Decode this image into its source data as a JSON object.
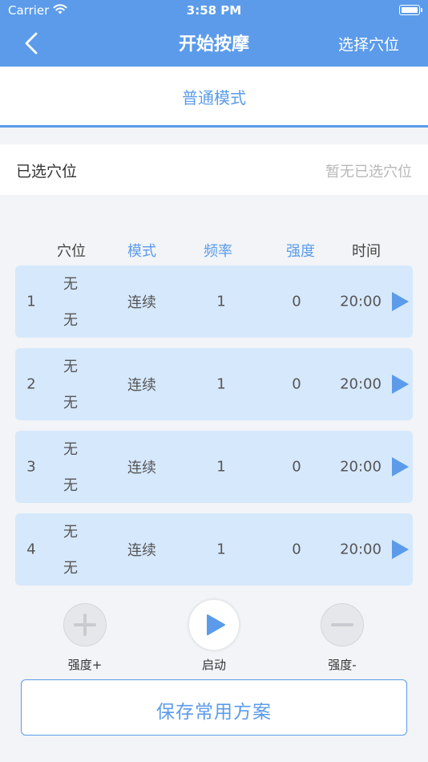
{
  "status_bar": {
    "carrier": "Carrier",
    "time": "3:58 PM",
    "wifi_icon": "wifi-icon",
    "battery_icon": "battery-icon"
  },
  "nav": {
    "back_icon": "chevron-left-icon",
    "title": "开始按摩",
    "select_acupoint": "选择穴位"
  },
  "mode_tab": {
    "label": "普通模式"
  },
  "selected": {
    "label": "已选穴位",
    "value": "暂无已选穴位"
  },
  "table": {
    "headers": [
      "穴位",
      "模式",
      "频率",
      "强度",
      "时间"
    ],
    "header_colors": [
      "#444444",
      "#5b9bea",
      "#5b9bea",
      "#5b9bea",
      "#444444"
    ],
    "rows": [
      {
        "index": "1",
        "point_top": "无",
        "point_bottom": "无",
        "mode": "连续",
        "frequency": "1",
        "intensity": "0",
        "time": "20:00"
      },
      {
        "index": "2",
        "point_top": "无",
        "point_bottom": "无",
        "mode": "连续",
        "frequency": "1",
        "intensity": "0",
        "time": "20:00"
      },
      {
        "index": "3",
        "point_top": "无",
        "point_bottom": "无",
        "mode": "连续",
        "frequency": "1",
        "intensity": "0",
        "time": "20:00"
      },
      {
        "index": "4",
        "point_top": "无",
        "point_bottom": "无",
        "mode": "连续",
        "frequency": "1",
        "intensity": "0",
        "time": "20:00"
      }
    ]
  },
  "controls": {
    "increase": "强度+",
    "start": "启动",
    "decrease": "强度-"
  },
  "save_button": "保存常用方案",
  "colors": {
    "accent": "#5b9bea",
    "row_background": "#d6e8fc",
    "page_background": "#f2f4f7"
  }
}
